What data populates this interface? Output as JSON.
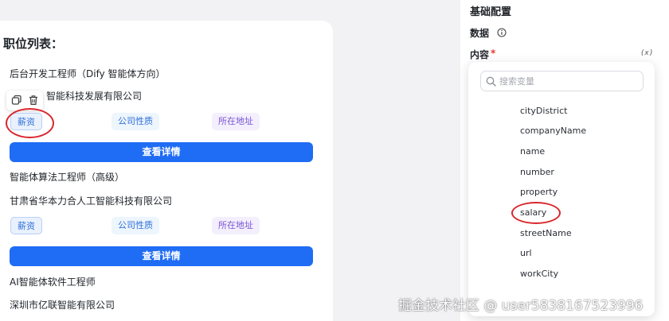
{
  "job_list": {
    "title": "职位列表：",
    "jobs": [
      {
        "title": "后台开发工程师（Dify 智能体方向）",
        "company": "甘肃省华本力合人工智能科技发展有限公司",
        "tags": [
          "薪资",
          "公司性质",
          "所在地址"
        ],
        "button": "查看详情"
      },
      {
        "title": "智能体算法工程师（高级）",
        "company": "甘肃省华本力合人工智能科技有限公司",
        "tags": [
          "薪资",
          "公司性质",
          "所在地址"
        ],
        "button": "查看详情"
      },
      {
        "title": "AI智能体软件工程师",
        "company": "深圳市亿联智能有限公司"
      }
    ],
    "first_company_visible": "智能科技发展有限公司"
  },
  "config": {
    "heading": "基础配置",
    "data_label": "数据",
    "content_label": "内容",
    "required_mark": "*",
    "variable_icon": "(x)"
  },
  "variable_picker": {
    "search_placeholder": "搜索变量",
    "items": [
      "cityDistrict",
      "companyName",
      "name",
      "number",
      "property",
      "salary",
      "streetName",
      "url",
      "workCity"
    ]
  },
  "watermark": "掘金技术社区 @ user5838167523996",
  "colors": {
    "primary": "#1f6cf5",
    "highlight_circle": "#d9262c",
    "tag_purple": "#7a55d4"
  }
}
